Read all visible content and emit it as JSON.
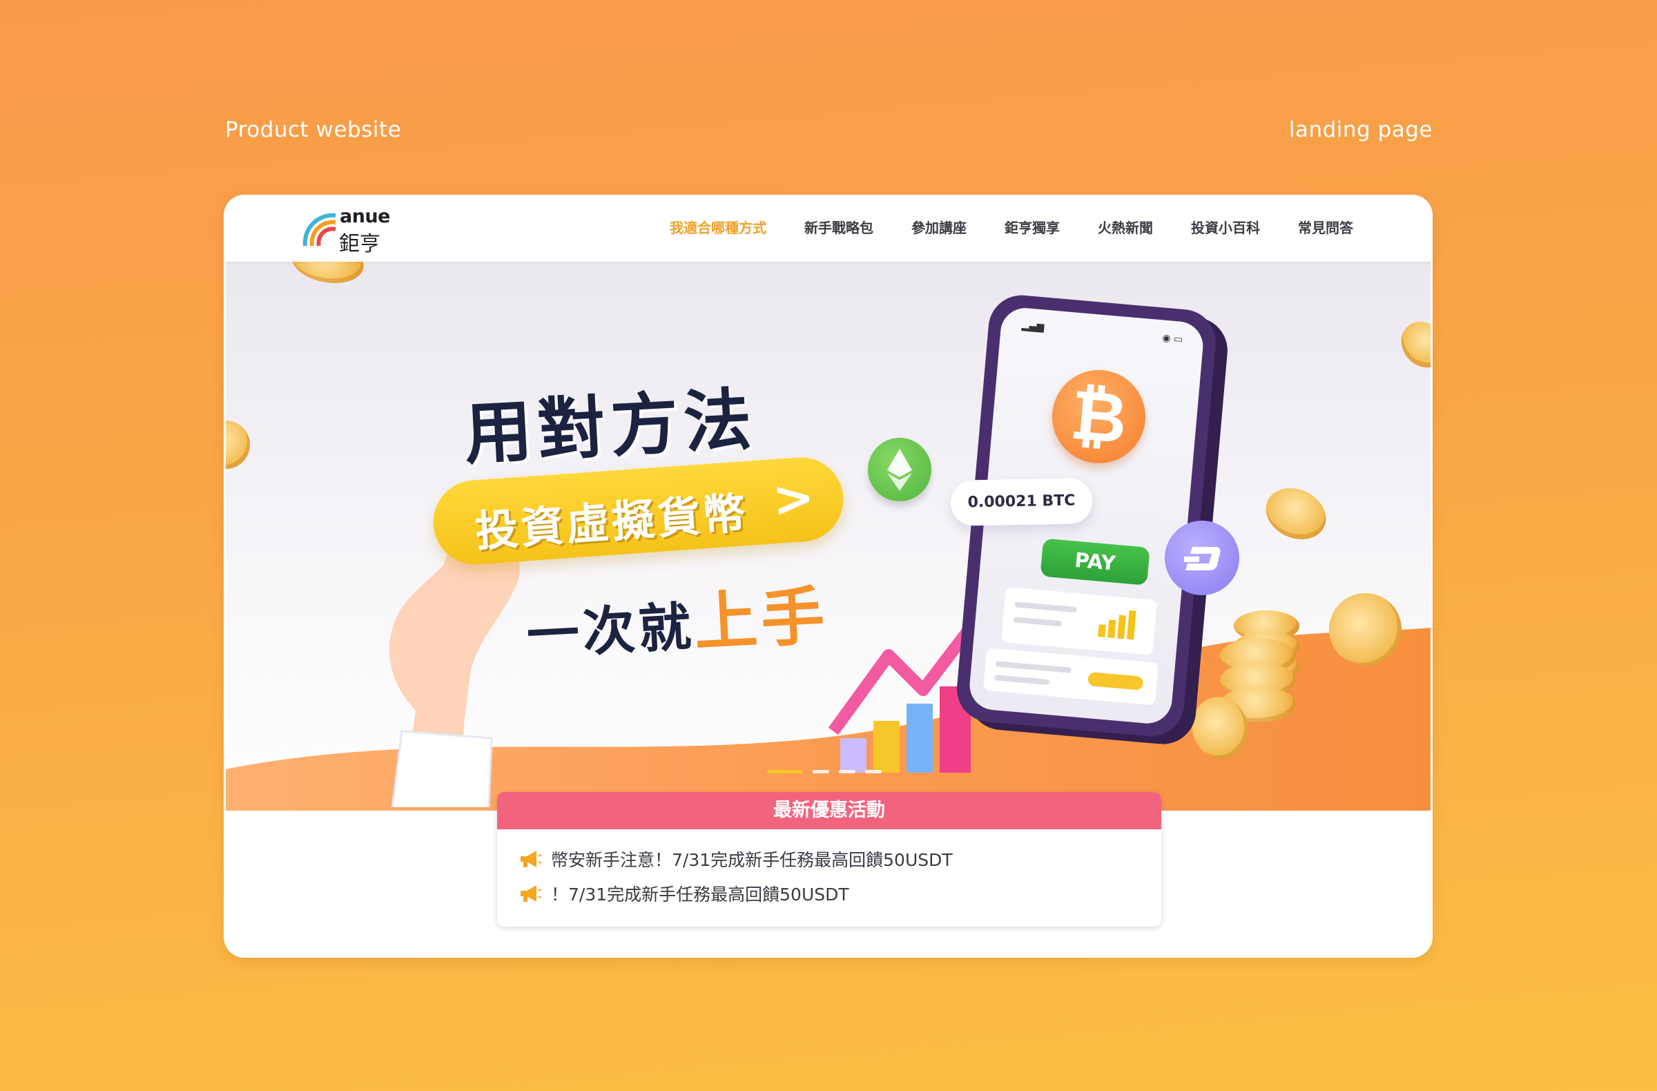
{
  "captions": {
    "left": "Product website",
    "right": "landing page"
  },
  "header": {
    "logo_en": "anue",
    "logo_zh": "鉅亨",
    "nav": [
      {
        "label": "我適合哪種方式",
        "active": true
      },
      {
        "label": "新手戰略包",
        "active": false
      },
      {
        "label": "參加講座",
        "active": false
      },
      {
        "label": "鉅亨獨享",
        "active": false
      },
      {
        "label": "火熱新聞",
        "active": false
      },
      {
        "label": "投資小百科",
        "active": false
      },
      {
        "label": "常見問答",
        "active": false
      }
    ]
  },
  "hero": {
    "line1": "用對方法",
    "pill": "投資虛擬貨幣",
    "pill_arrow": ">",
    "line3_a": "一次就",
    "line3_b": "上手",
    "btc_amount": "0.00021 BTC",
    "pay_label": "PAY",
    "btc_symbol": "₿",
    "slides_total": 4,
    "slide_active": 1
  },
  "promo": {
    "title": "最新優惠活動",
    "items": [
      "幣安新手注意！7/31完成新手任務最高回饋50USDT",
      "！7/31完成新手任務最高回饋50USDT"
    ]
  },
  "colors": {
    "accent": "#f0a028",
    "promo_header": "#f2647e",
    "background_top": "#f89a4a",
    "background_bottom": "#fbbf44"
  }
}
